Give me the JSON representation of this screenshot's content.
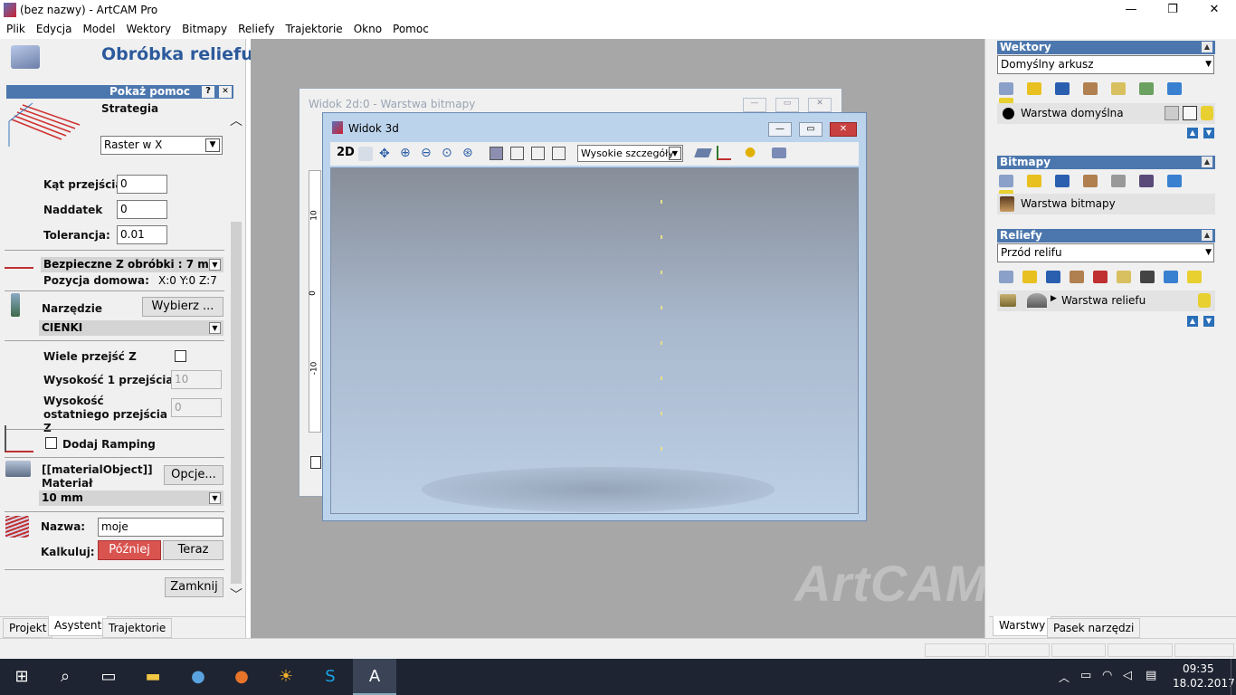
{
  "window": {
    "title": "(bez nazwy) - ArtCAM Pro",
    "minimize": "—",
    "maximize": "❐",
    "close": "✕"
  },
  "menu": [
    "Plik",
    "Edycja",
    "Model",
    "Wektory",
    "Bitmapy",
    "Reliefy",
    "Trajektorie",
    "Okno",
    "Pomoc"
  ],
  "left": {
    "heading": "Obróbka reliefu",
    "help": "Pokaż pomoc",
    "help_q": "?",
    "help_x": "✕",
    "strategy_label": "Strategia",
    "strategy_value": "Raster w X",
    "kat_label": "Kąt przejścia:",
    "kat_value": "0",
    "naddatek_label": "Naddatek",
    "naddatek_value": "0",
    "tol_label": "Tolerancja:",
    "tol_value": "0.01",
    "safez": "Bezpieczne Z obróbki : 7 mm",
    "home_label": "Pozycja domowa:",
    "home_value": "X:0 Y:0 Z:7",
    "tool_label": "Narzędzie",
    "tool_button": "Wybierz ...",
    "tool_name": "CIENKI",
    "multi_label": "Wiele przejść Z",
    "h1_label": "Wysokość 1 przejścia Z",
    "h1_value": "10",
    "hlast_label": "Wysokość ostatniego przejścia Z",
    "hlast_value": "0",
    "ramp_label": "Dodaj Ramping",
    "material_obj": "[[materialObject]]",
    "material_label": "Materiał",
    "material_button": "Opcje...",
    "material_value": "10 mm",
    "name_label": "Nazwa:",
    "name_value": "moje",
    "calc_label": "Kalkuluj:",
    "later": "Później",
    "now": "Teraz",
    "close": "Zamknij",
    "tabs": [
      "Projekt",
      "Asystent",
      "Trajektorie"
    ]
  },
  "view2d": {
    "title": "Widok 2d:0 - Warstwa bitmapy",
    "ticks": [
      "10",
      "0",
      "-10"
    ]
  },
  "view3d": {
    "title": "Widok 3d",
    "mode2d": "2D",
    "detail": "Wysokie szczegóły"
  },
  "watermark": "ArtCAM",
  "right": {
    "vectors": {
      "title": "Wektory",
      "sheet": "Domyślny arkusz",
      "layer": "Warstwa domyślna",
      "layer_color": "#000000"
    },
    "bitmaps": {
      "title": "Bitmapy",
      "layer": "Warstwa bitmapy"
    },
    "reliefs": {
      "title": "Reliefy",
      "front": "Przód relifu",
      "layer": "Warstwa reliefu"
    },
    "tabs": [
      "Warstwy",
      "Pasek narzędzi"
    ]
  },
  "taskbar": {
    "time": "09:35",
    "date": "18.02.2017"
  }
}
